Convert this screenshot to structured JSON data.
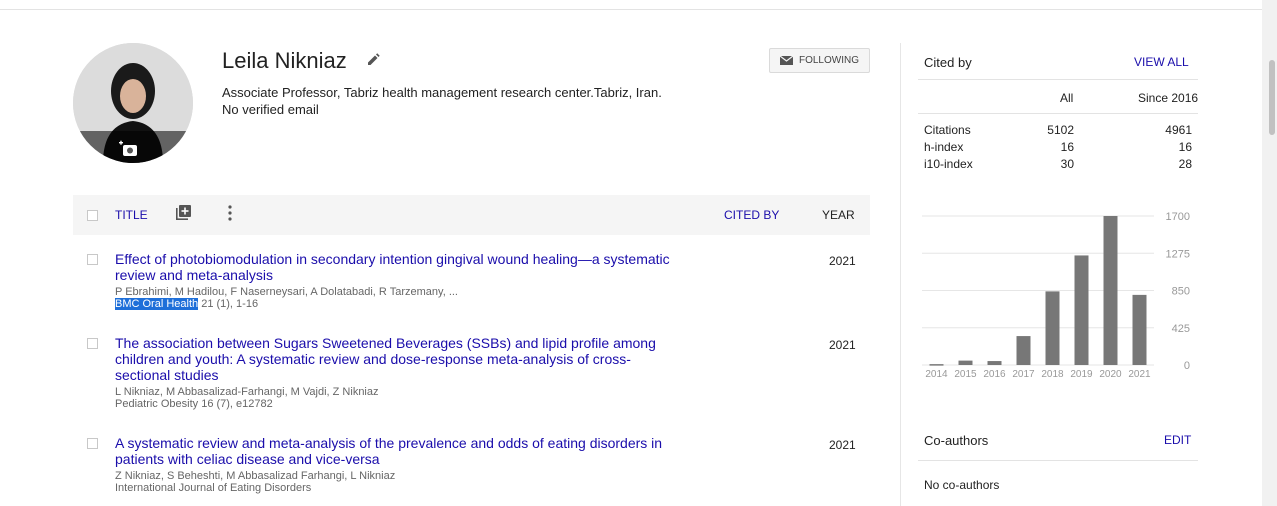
{
  "profile": {
    "name": "Leila Nikniaz",
    "affiliation": "Associate Professor, Tabriz health management research center.Tabriz, Iran.",
    "email_status": "No verified email",
    "follow_label": "FOLLOWING"
  },
  "table": {
    "title_header": "TITLE",
    "cited_by_header": "CITED BY",
    "year_header": "YEAR"
  },
  "articles": [
    {
      "title_line1": "Effect of photobiomodulation in secondary intention gingival wound healing—a systematic",
      "title_line2": "review and meta-analysis",
      "authors": "P Ebrahimi, M Hadilou, F Naserneysari, A Dolatabadi, R Tarzemany, ...",
      "journal": "BMC Oral Health",
      "journal_rest": " 21 (1), 1-16",
      "year": "2021"
    },
    {
      "title_line1": "The association between Sugars Sweetened Beverages (SSBs) and lipid profile among",
      "title_line2": "children and youth: A systematic review and dose-response meta-analysis of cross-",
      "title_line3": "sectional studies",
      "authors": "L Nikniaz, M Abbasalizad-Farhangi, M Vajdi, Z Nikniaz",
      "journal": "Pediatric Obesity 16 (7), e12782",
      "year": "2021"
    },
    {
      "title_line1": "A systematic review and meta-analysis of the prevalence and odds of eating disorders in",
      "title_line2": "patients with celiac disease and vice-versa",
      "authors": "Z Nikniaz, S Beheshti, M Abbasalizad Farhangi, L Nikniaz",
      "journal": "International Journal of Eating Disorders",
      "year": "2021"
    }
  ],
  "cited_by": {
    "title": "Cited by",
    "view_all": "VIEW ALL",
    "col_all": "All",
    "col_since": "Since 2016",
    "rows": [
      {
        "label": "Citations",
        "all": "5102",
        "since": "4961"
      },
      {
        "label": "h-index",
        "all": "16",
        "since": "16"
      },
      {
        "label": "i10-index",
        "all": "30",
        "since": "28"
      }
    ]
  },
  "chart_data": {
    "type": "bar",
    "categories": [
      "2014",
      "2015",
      "2016",
      "2017",
      "2018",
      "2019",
      "2020",
      "2021"
    ],
    "values": [
      10,
      50,
      45,
      330,
      840,
      1250,
      1700,
      800
    ],
    "y_ticks": [
      "0",
      "425",
      "850",
      "1275",
      "1700"
    ],
    "ylim": [
      0,
      1700
    ],
    "bar_color": "#777777",
    "grid": true,
    "title": "",
    "xlabel": "",
    "ylabel": ""
  },
  "coauthors": {
    "title": "Co-authors",
    "edit": "EDIT",
    "empty": "No co-authors"
  },
  "colors": {
    "link": "#1a0dab",
    "highlight": "#1e6fd9"
  }
}
